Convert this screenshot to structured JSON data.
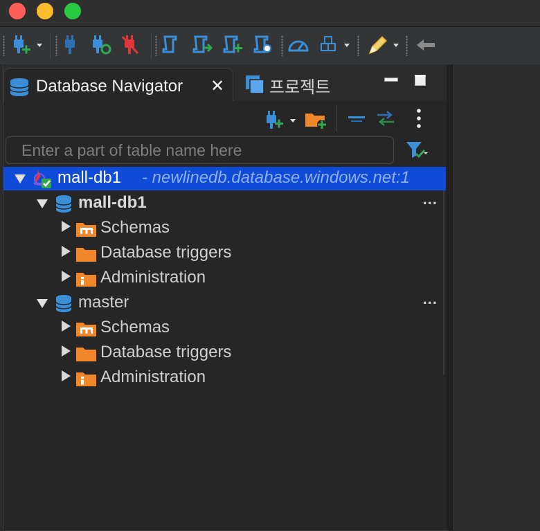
{
  "colors": {
    "selection": "#0f4bd6",
    "folder": "#f0872a",
    "db": "#3b8fd9",
    "plug_blue": "#3b8fd9",
    "plug_red": "#e0353b",
    "plus_green": "#32a852"
  },
  "toolbar": {
    "icons": [
      "new-connection-icon",
      "connect-icon",
      "reconnect-icon",
      "disconnect-icon",
      "sql-editor-icon",
      "open-sql-script-icon",
      "new-sql-script-icon",
      "find-object-icon",
      "dashboard-icon",
      "transaction-mode-icon",
      "edit-tools-icon",
      "back-navigation-icon"
    ]
  },
  "panel": {
    "tab_active": "Database Navigator",
    "tab_inactive": "프로젝트",
    "filter_placeholder": "Enter a part of table name here"
  },
  "tree": {
    "connection": {
      "name": "mall-db1",
      "host": "- newlinedb.database.windows.net:1"
    },
    "databases": [
      {
        "name": "mall-db1",
        "bold": true,
        "more": "...",
        "children": [
          "Schemas",
          "Database triggers",
          "Administration"
        ]
      },
      {
        "name": "master",
        "bold": false,
        "more": "...",
        "children": [
          "Schemas",
          "Database triggers",
          "Administration"
        ]
      }
    ]
  }
}
